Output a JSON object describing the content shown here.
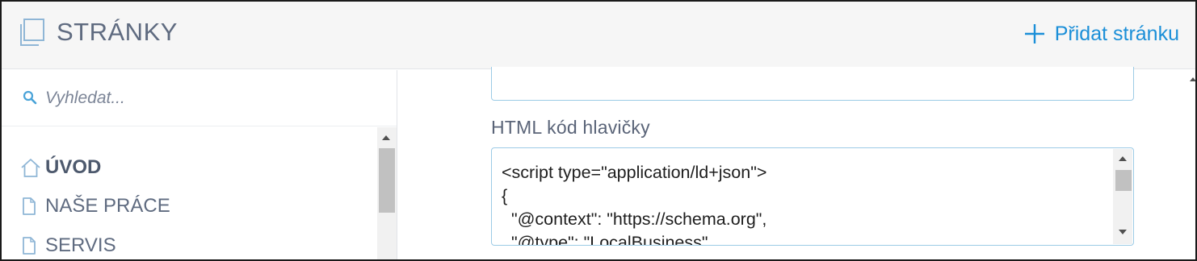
{
  "header": {
    "title": "STRÁNKY",
    "add_page_label": "Přidat stránku",
    "icon": "pages-icon"
  },
  "sidebar": {
    "search": {
      "placeholder": "Vyhledat...",
      "value": ""
    },
    "items": [
      {
        "label": "ÚVOD",
        "icon": "home-icon",
        "active": true
      },
      {
        "label": "NAŠE PRÁCE",
        "icon": "page-icon",
        "active": false
      },
      {
        "label": "SERVIS",
        "icon": "page-icon",
        "active": false
      }
    ]
  },
  "main": {
    "header_code_label": "HTML kód hlavičky",
    "header_code_value": "<script type=\"application/ld+json\">\n{\n  \"@context\": \"https://schema.org\",\n  \"@type\": \"LocalBusiness\","
  },
  "colors": {
    "accent": "#1b8fd8",
    "text": "#5f6b80",
    "field_border": "#9ccbe6",
    "header_bg": "#f6f6f6"
  }
}
